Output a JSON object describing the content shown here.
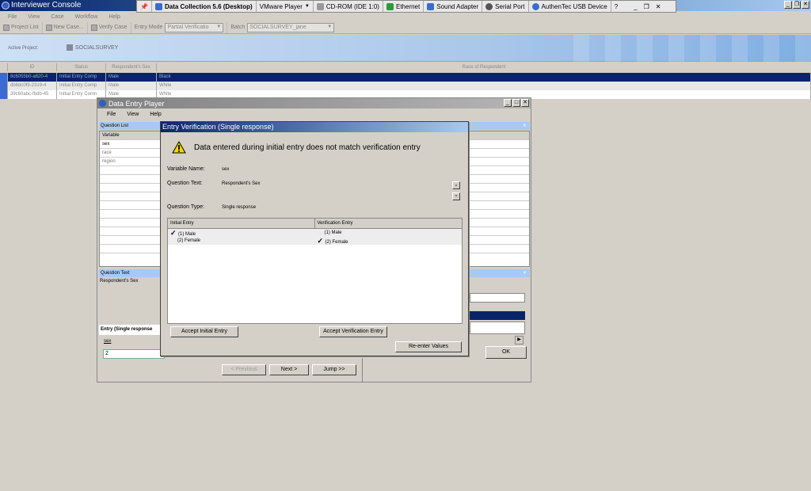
{
  "main_window": {
    "title": "Interviewer Console"
  },
  "vmware_bar": {
    "app_title": "Data Collection 5.6 (Desktop)",
    "player": "VMware Player",
    "devices": [
      "CD-ROM (IDE 1:0)",
      "Ethernet",
      "Sound Adapter",
      "Serial Port",
      "AuthenTec USB Device"
    ]
  },
  "menu": [
    "File",
    "View",
    "Case",
    "Workflow",
    "Help"
  ],
  "toolbar": {
    "project_list": "Project List",
    "new_case": "New Case...",
    "verify_case": "Verify Case",
    "entry_mode_label": "Entry Mode",
    "entry_mode_value": "Partial Verificatio",
    "batch_label": "Batch",
    "batch_value": "SOCIALSURVEY_jane"
  },
  "banner": {
    "label": "Active Project:",
    "project": "SOCIALSURVEY"
  },
  "grid": {
    "columns": [
      "ID",
      "Status",
      "Respondent's Sex",
      "Race of Respondent"
    ],
    "rows": [
      {
        "id": "8c6055b0-a620-4",
        "status": "Initial Entry Comp",
        "sex": "Male",
        "race": "Black"
      },
      {
        "id": "db8dc0f9-2319-4",
        "status": "Initial Entry Comp",
        "sex": "Male",
        "race": "White"
      },
      {
        "id": "39c60abc-fbdb-45",
        "status": "Initial Entry Comn",
        "sex": "Male",
        "race": "White"
      }
    ]
  },
  "dep": {
    "title": "Data Entry Player",
    "menu": [
      "File",
      "View",
      "Help"
    ],
    "question_list_head": "Question List",
    "variable_col": "Variable",
    "variables": [
      "sex",
      "race",
      "region"
    ],
    "question_text_head": "Question Text",
    "question_text": "Respondent's Sex",
    "entry_head": "Entry (Single response",
    "entry_var": "sex",
    "entry_value": "2",
    "previous": "< Previous",
    "next": "Next >",
    "jump": "Jump >>",
    "ok": "OK"
  },
  "dialog": {
    "title": "Entry Verification (Single response)",
    "headline": "Data entered during initial entry does not match verification entry",
    "variable_label": "Variable Name:",
    "variable_value": "sex",
    "question_label": "Question Text:",
    "question_value": "Respondent's Sex",
    "type_label": "Question Type:",
    "type_value": "Single response",
    "col_initial": "Initial Entry",
    "col_verification": "Verification Entry",
    "initial_options": [
      "(1)  Male",
      "(2)  Female"
    ],
    "verification_options": [
      "(1)  Male",
      "(2)  Female"
    ],
    "accept_initial": "Accept Initial Entry",
    "accept_verification": "Accept Verification Entry",
    "reenter": "Re-enter Values"
  }
}
